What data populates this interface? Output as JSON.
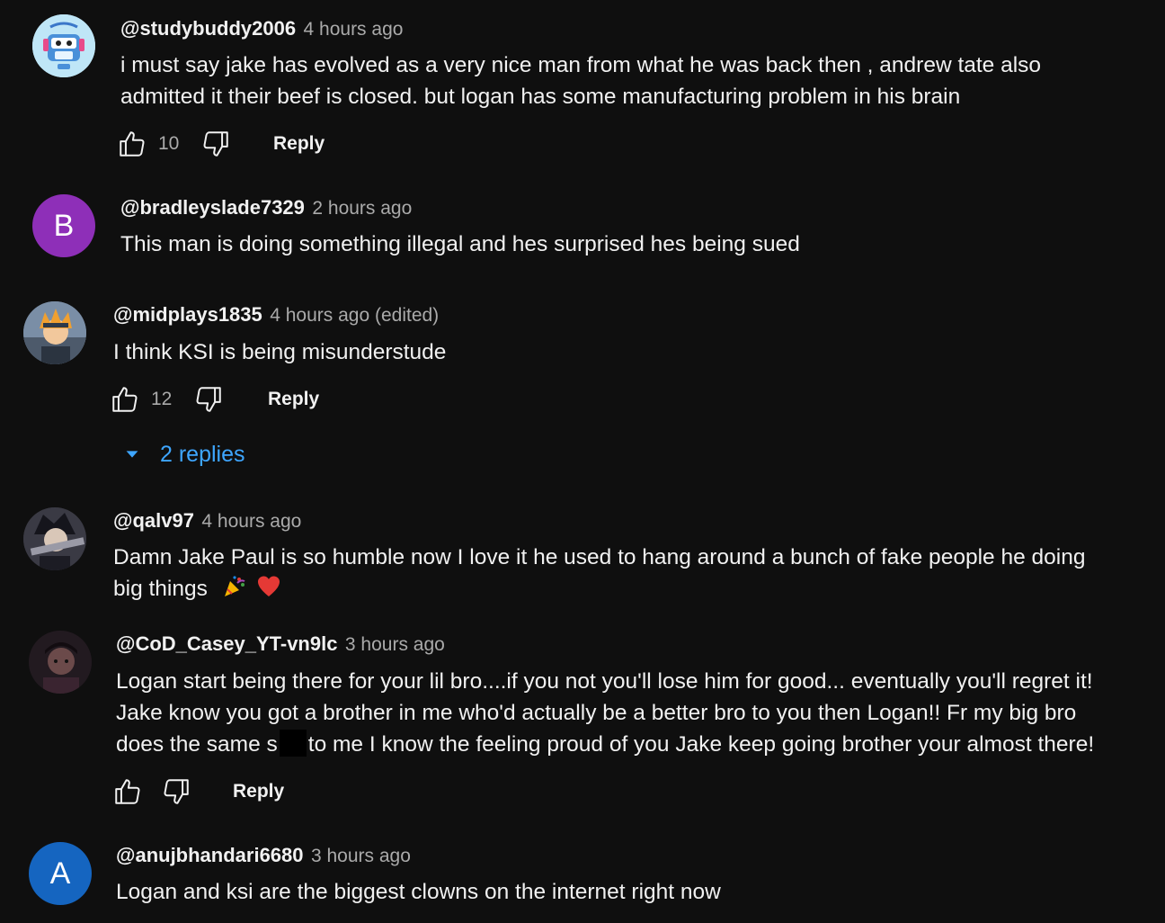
{
  "comments": [
    {
      "handle": "@studybuddy2006",
      "time": "4 hours ago",
      "lines": [
        "i must say jake has evolved as a very nice man from what he was back then , andrew tate also",
        "admitted it their beef is closed. but logan has some manufacturing problem in his brain"
      ],
      "likes": "10",
      "reply_label": "Reply"
    },
    {
      "handle": "@bradleyslade7329",
      "time": "2 hours ago",
      "avatar_letter": "B",
      "avatar_color": "#8e2fb8",
      "lines": [
        "This man is doing something illegal and hes surprised hes being sued"
      ]
    },
    {
      "handle": "@midplays1835",
      "time": "4 hours ago (edited)",
      "lines": [
        "I think KSI is being misunderstude"
      ],
      "likes": "12",
      "reply_label": "Reply",
      "replies_label": "2 replies"
    },
    {
      "handle": "@qalv97",
      "time": "4 hours ago",
      "lines": [
        "Damn Jake Paul is so humble now I love it he used to hang around a bunch of fake people he doing",
        "big things"
      ]
    },
    {
      "handle": "@CoD_Casey_YT-vn9lc",
      "time": "3 hours ago",
      "lines": [
        "Logan start being there for your lil bro....if you not you'll lose him for good... eventually you'll regret it!",
        "Jake know you got a brother in me who'd actually be a better bro to you then Logan!! Fr my big bro"
      ],
      "line3_before": "does the same s",
      "line3_after": "to me I know the feeling proud of you Jake keep going brother your almost there!",
      "reply_label": "Reply"
    },
    {
      "handle": "@anujbhandari6680",
      "time": "3 hours ago",
      "avatar_letter": "A",
      "avatar_color": "#1565c0",
      "lines": [
        "Logan and ksi are the biggest clowns on the internet right now"
      ]
    }
  ],
  "colors": {
    "background": "#0f0f0f",
    "text": "#f1f1f1",
    "secondary": "#aaaaaa",
    "link": "#3ea6ff"
  },
  "icons": [
    "thumbs-up-icon",
    "thumbs-down-icon",
    "caret-down-icon",
    "party-popper-emoji",
    "red-heart-emoji"
  ]
}
